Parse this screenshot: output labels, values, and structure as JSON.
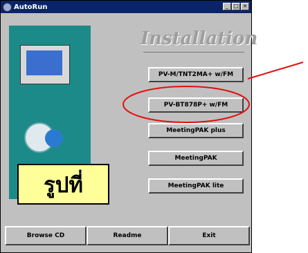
{
  "window": {
    "title": "AutoRun",
    "controls": [
      "minimize-icon",
      "maximize-icon",
      "close-icon"
    ]
  },
  "main": {
    "heading": "Installation",
    "buttons": [
      {
        "label": "PV-M/TNT2MA+ w/FM"
      },
      {
        "label": "PV-BT878P+ w/FM"
      },
      {
        "label": "MeetingPAK plus"
      },
      {
        "label": "MeetingPAK"
      },
      {
        "label": "MeetingPAK lite"
      }
    ]
  },
  "bottom": {
    "buttons": [
      {
        "label": "Browse CD"
      },
      {
        "label": "Readme"
      },
      {
        "label": "Exit"
      }
    ]
  },
  "annotation": {
    "label": "รูปที่",
    "highlight_color": "#e01010",
    "label_bg": "#ffff99"
  }
}
